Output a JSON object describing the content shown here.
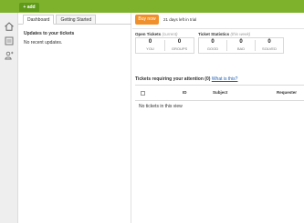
{
  "topbar": {
    "add_label": "+ add"
  },
  "nav": [
    {
      "icon": "home-icon"
    },
    {
      "icon": "views-icon"
    },
    {
      "icon": "users-icon"
    }
  ],
  "left": {
    "tabs": [
      {
        "label": "Dashboard",
        "active": true
      },
      {
        "label": "Getting Started",
        "active": false
      }
    ],
    "updates_title": "Updates to your tickets",
    "updates_text": "No recent updates."
  },
  "trial": {
    "buy_label": "Buy now",
    "text": "21 days left in trial"
  },
  "open_tickets": {
    "title": "Open Tickets",
    "subtitle": "(current)",
    "stats": [
      {
        "value": "0",
        "label": "YOU"
      },
      {
        "value": "0",
        "label": "GROUPS"
      }
    ]
  },
  "ticket_statistics": {
    "title": "Ticket Statistics",
    "subtitle": "(this week)",
    "stats": [
      {
        "value": "0",
        "label": "GOOD"
      },
      {
        "value": "0",
        "label": "BAD"
      },
      {
        "value": "0",
        "label": "SOLVED"
      }
    ]
  },
  "attention": {
    "title": "Tickets requiring your attention (0)",
    "link": "What is this?",
    "columns": [
      "ID",
      "Subject",
      "Requester"
    ],
    "empty_text": "No tickets in this view"
  }
}
